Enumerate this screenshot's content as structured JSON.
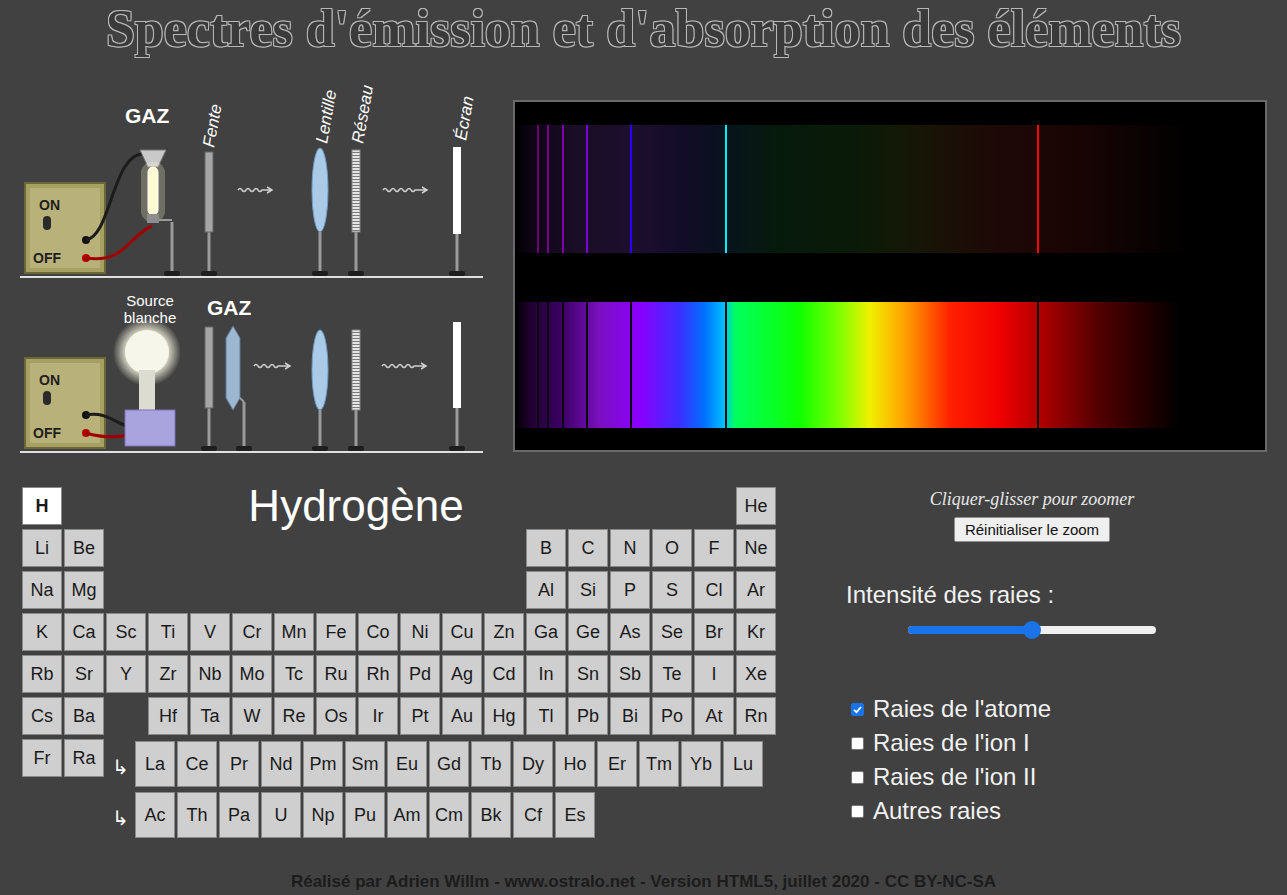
{
  "title": "Spectres d'émission et d'absorption des éléments",
  "setup": {
    "emission": {
      "gas_label": "GAZ",
      "switch_on": "ON",
      "switch_off": "OFF",
      "parts": [
        "Fente",
        "Lentille",
        "Réseau",
        "Écran"
      ]
    },
    "absorption": {
      "source_label_lines": [
        "Source",
        "blanche"
      ],
      "gas_label": "GAZ",
      "switch_on": "ON",
      "switch_off": "OFF"
    }
  },
  "spectrum": {
    "lines_nm": [
      383.5,
      388.9,
      397.0,
      410.2,
      434.0,
      486.1,
      656.3
    ]
  },
  "element_name": "Hydrogène",
  "periodic_table": {
    "periods": [
      [
        {
          "symbol": "H",
          "selected": true
        },
        {
          "symbol": "He",
          "selected": false
        }
      ],
      [
        {
          "symbol": "Li",
          "selected": false
        },
        {
          "symbol": "Be",
          "selected": false
        },
        {
          "symbol": "B",
          "selected": false
        },
        {
          "symbol": "C",
          "selected": false
        },
        {
          "symbol": "N",
          "selected": false
        },
        {
          "symbol": "O",
          "selected": false
        },
        {
          "symbol": "F",
          "selected": false
        },
        {
          "symbol": "Ne",
          "selected": false
        }
      ],
      [
        {
          "symbol": "Na",
          "selected": false
        },
        {
          "symbol": "Mg",
          "selected": false
        },
        {
          "symbol": "Al",
          "selected": false
        },
        {
          "symbol": "Si",
          "selected": false
        },
        {
          "symbol": "P",
          "selected": false
        },
        {
          "symbol": "S",
          "selected": false
        },
        {
          "symbol": "Cl",
          "selected": false
        },
        {
          "symbol": "Ar",
          "selected": false
        }
      ],
      [
        {
          "symbol": "K",
          "selected": false
        },
        {
          "symbol": "Ca",
          "selected": false
        },
        {
          "symbol": "Sc",
          "selected": false
        },
        {
          "symbol": "Ti",
          "selected": false
        },
        {
          "symbol": "V",
          "selected": false
        },
        {
          "symbol": "Cr",
          "selected": false
        },
        {
          "symbol": "Mn",
          "selected": false
        },
        {
          "symbol": "Fe",
          "selected": false
        },
        {
          "symbol": "Co",
          "selected": false
        },
        {
          "symbol": "Ni",
          "selected": false
        },
        {
          "symbol": "Cu",
          "selected": false
        },
        {
          "symbol": "Zn",
          "selected": false
        },
        {
          "symbol": "Ga",
          "selected": false
        },
        {
          "symbol": "Ge",
          "selected": false
        },
        {
          "symbol": "As",
          "selected": false
        },
        {
          "symbol": "Se",
          "selected": false
        },
        {
          "symbol": "Br",
          "selected": false
        },
        {
          "symbol": "Kr",
          "selected": false
        }
      ],
      [
        {
          "symbol": "Rb",
          "selected": false
        },
        {
          "symbol": "Sr",
          "selected": false
        },
        {
          "symbol": "Y",
          "selected": false
        },
        {
          "symbol": "Zr",
          "selected": false
        },
        {
          "symbol": "Nb",
          "selected": false
        },
        {
          "symbol": "Mo",
          "selected": false
        },
        {
          "symbol": "Tc",
          "selected": false
        },
        {
          "symbol": "Ru",
          "selected": false
        },
        {
          "symbol": "Rh",
          "selected": false
        },
        {
          "symbol": "Pd",
          "selected": false
        },
        {
          "symbol": "Ag",
          "selected": false
        },
        {
          "symbol": "Cd",
          "selected": false
        },
        {
          "symbol": "In",
          "selected": false
        },
        {
          "symbol": "Sn",
          "selected": false
        },
        {
          "symbol": "Sb",
          "selected": false
        },
        {
          "symbol": "Te",
          "selected": false
        },
        {
          "symbol": "I",
          "selected": false
        },
        {
          "symbol": "Xe",
          "selected": false
        }
      ],
      [
        {
          "symbol": "Cs",
          "selected": false
        },
        {
          "symbol": "Ba",
          "selected": false
        },
        {
          "symbol": "Hf",
          "selected": false
        },
        {
          "symbol": "Ta",
          "selected": false
        },
        {
          "symbol": "W",
          "selected": false
        },
        {
          "symbol": "Re",
          "selected": false
        },
        {
          "symbol": "Os",
          "selected": false
        },
        {
          "symbol": "Ir",
          "selected": false
        },
        {
          "symbol": "Pt",
          "selected": false
        },
        {
          "symbol": "Au",
          "selected": false
        },
        {
          "symbol": "Hg",
          "selected": false
        },
        {
          "symbol": "Tl",
          "selected": false
        },
        {
          "symbol": "Pb",
          "selected": false
        },
        {
          "symbol": "Bi",
          "selected": false
        },
        {
          "symbol": "Po",
          "selected": false
        },
        {
          "symbol": "At",
          "selected": false
        },
        {
          "symbol": "Rn",
          "selected": false
        }
      ]
    ],
    "period_7": [
      {
        "symbol": "Fr",
        "selected": false
      },
      {
        "symbol": "Ra",
        "selected": false
      }
    ],
    "f_block": [
      {
        "arrow": "↳",
        "elements": [
          {
            "symbol": "La",
            "selected": false
          },
          {
            "symbol": "Ce",
            "selected": false
          },
          {
            "symbol": "Pr",
            "selected": false
          },
          {
            "symbol": "Nd",
            "selected": false
          },
          {
            "symbol": "Pm",
            "selected": false
          },
          {
            "symbol": "Sm",
            "selected": false
          },
          {
            "symbol": "Eu",
            "selected": false
          },
          {
            "symbol": "Gd",
            "selected": false
          },
          {
            "symbol": "Tb",
            "selected": false
          },
          {
            "symbol": "Dy",
            "selected": false
          },
          {
            "symbol": "Ho",
            "selected": false
          },
          {
            "symbol": "Er",
            "selected": false
          },
          {
            "symbol": "Tm",
            "selected": false
          },
          {
            "symbol": "Yb",
            "selected": false
          },
          {
            "symbol": "Lu",
            "selected": false
          }
        ]
      },
      {
        "arrow": "↳",
        "elements": [
          {
            "symbol": "Ac",
            "selected": false
          },
          {
            "symbol": "Th",
            "selected": false
          },
          {
            "symbol": "Pa",
            "selected": false
          },
          {
            "symbol": "U",
            "selected": false
          },
          {
            "symbol": "Np",
            "selected": false
          },
          {
            "symbol": "Pu",
            "selected": false
          },
          {
            "symbol": "Am",
            "selected": false
          },
          {
            "symbol": "Cm",
            "selected": false
          },
          {
            "symbol": "Bk",
            "selected": false
          },
          {
            "symbol": "Cf",
            "selected": false
          },
          {
            "symbol": "Es",
            "selected": false
          }
        ]
      }
    ]
  },
  "zoom": {
    "hint": "Cliquer-glisser pour zoomer",
    "reset_button": "Réinitialiser le zoom"
  },
  "intensity": {
    "label": "Intensité des raies :",
    "level": 0.5
  },
  "options": [
    {
      "label": "Raies de l'atome",
      "checked": true
    },
    {
      "label": "Raies de l'ion I",
      "checked": false
    },
    {
      "label": "Raies de l'ion II",
      "checked": false
    },
    {
      "label": "Autres raies",
      "checked": false
    }
  ],
  "footer": "Réalisé par Adrien Willm - www.ostralo.net - Version HTML5, juillet 2020 - CC BY-NC-SA"
}
